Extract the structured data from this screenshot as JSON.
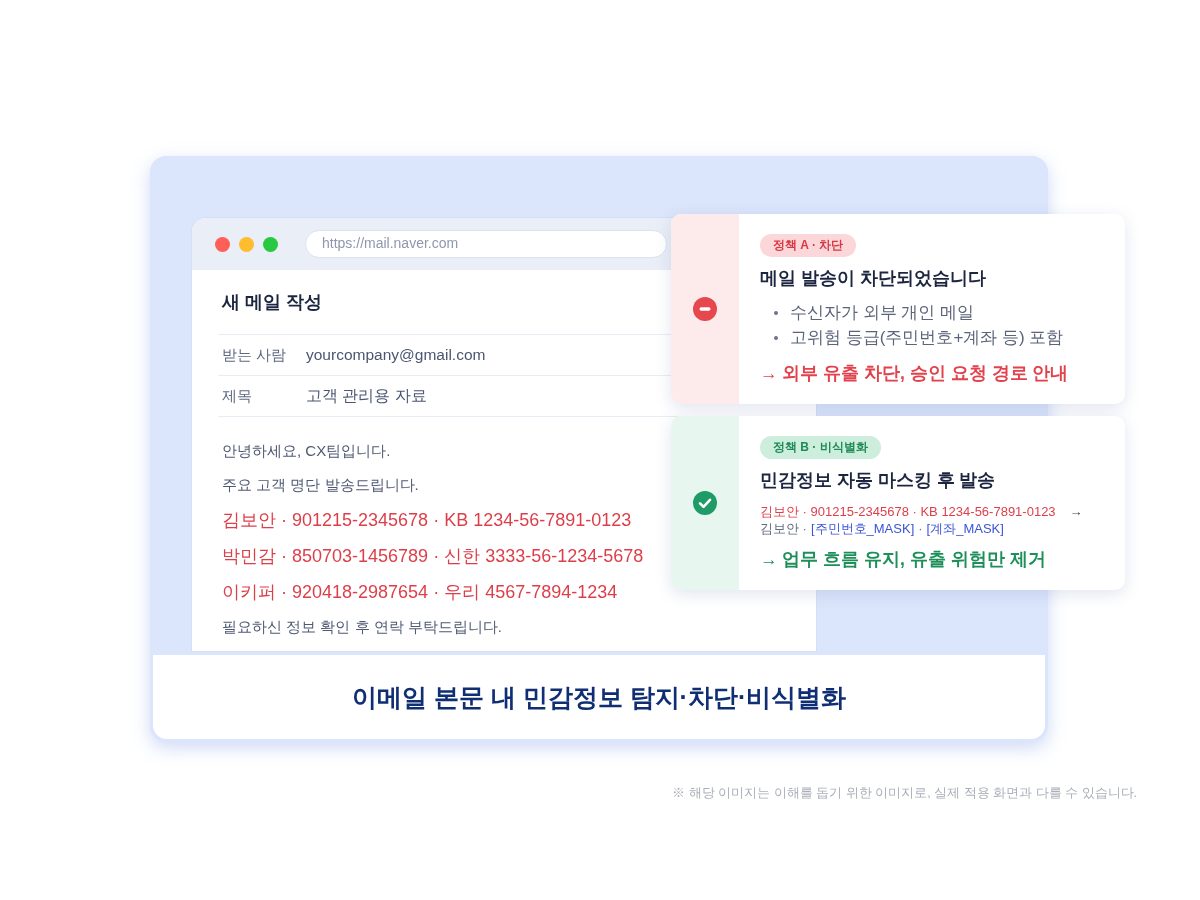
{
  "browser": {
    "url": "https://mail.naver.com",
    "compose": {
      "title": "새 메일 작성",
      "fields": [
        {
          "label": "받는 사람",
          "value": "yourcompany@gmail.com"
        },
        {
          "label": "제목",
          "value": "고객 관리용 자료"
        }
      ],
      "body": [
        {
          "kind": "text",
          "text": "안녕하세요, CX팀입니다."
        },
        {
          "kind": "text",
          "text": "주요 고객 명단 발송드립니다."
        },
        {
          "kind": "sensitive",
          "text": "김보안 · 901215-2345678 · KB 1234-56-7891-0123"
        },
        {
          "kind": "sensitive",
          "text": "박민감 · 850703-1456789 · 신한 3333-56-1234-5678"
        },
        {
          "kind": "sensitive",
          "text": "이키퍼 · 920418-2987654 · 우리 4567-7894-1234"
        },
        {
          "kind": "text",
          "text": "필요하신 정보 확인 후 연락 부탁드립니다."
        }
      ]
    }
  },
  "policies": [
    {
      "kind": "block",
      "tag": "정책 A · 차단",
      "title": "메일 발송이 차단되었습니다",
      "bullets": [
        "수신자가 외부 개인 메일",
        "고위험 등급(주민번호+계좌 등) 포함"
      ],
      "result": "→ 외부 유출 차단, 승인 요청 경로 안내"
    },
    {
      "kind": "mask",
      "tag": "정책 B · 비식별화",
      "title": "민감정보 자동 마스킹 후 발송",
      "before": "김보안 · 901215-2345678 · KB 1234-56-7891-0123",
      "arrow": "→",
      "after": [
        {
          "kind": "plain",
          "text": "김보안 ·"
        },
        {
          "kind": "masked",
          "text": "[주민번호_MASK]"
        },
        {
          "kind": "plain",
          "text": "·"
        },
        {
          "kind": "masked",
          "text": "[계좌_MASK]"
        }
      ],
      "result": "→ 업무 흐름 유지, 유출 위험만 제거"
    }
  ],
  "caption": "이메일 본문 내 민감정보 탐지·차단·비식별화",
  "footnote": "※ 해당 이미지는 이해를 돕기 위한 이미지로, 실제 적용 화면과 다를 수 있습니다."
}
